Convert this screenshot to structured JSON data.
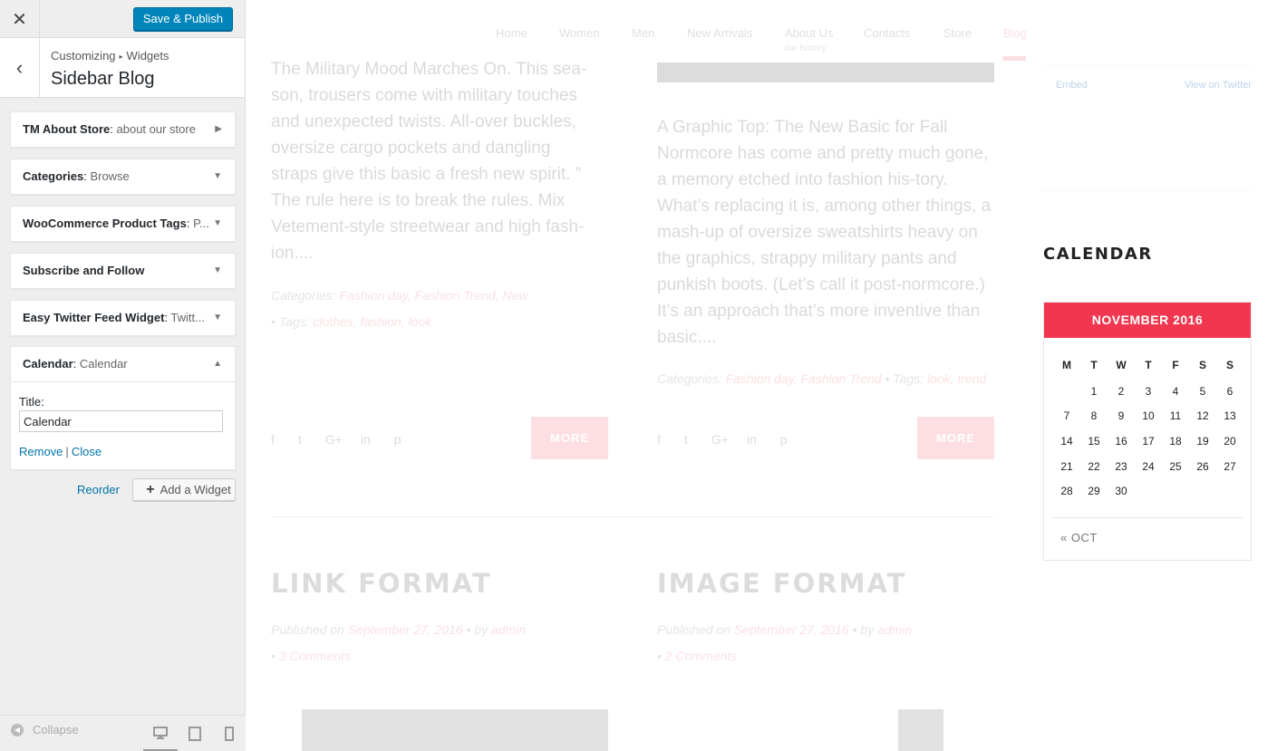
{
  "customizer": {
    "close_icon": "close-icon",
    "publish_label": "Save & Publish",
    "breadcrumb": {
      "root": "Customizing",
      "separator": "▸",
      "current": "Widgets"
    },
    "section_title": "Sidebar Blog",
    "widgets": [
      {
        "name": "TM About Store",
        "sub": "about our store",
        "arrow": "▶"
      },
      {
        "name": "Categories",
        "sub": "Browse",
        "arrow": "▼"
      },
      {
        "name": "WooCommerce Product Tags",
        "sub": "P...",
        "arrow": "▼"
      },
      {
        "name": "Subscribe and Follow",
        "sub": "",
        "arrow": "▼"
      },
      {
        "name": "Easy Twitter Feed Widget",
        "sub": "Twitt...",
        "arrow": "▼"
      },
      {
        "name": "Calendar",
        "sub": "Calendar",
        "arrow": "▲"
      }
    ],
    "calendar_form": {
      "title_label": "Title:",
      "title_value": "Calendar",
      "remove_label": "Remove",
      "separator": "|",
      "close_label": "Close"
    },
    "reorder_label": "Reorder",
    "add_widget_label": "Add a Widget",
    "collapse_label": "Collapse"
  },
  "preview": {
    "nav": {
      "items": [
        "Home",
        "Women",
        "Men",
        "New Arrivals",
        "About Us",
        "Contacts",
        "Store",
        "Blog"
      ],
      "about_sub": "our history"
    },
    "post1": {
      "text": "The Military Mood Marches On. This sea-son, trousers come with military touches and unexpected twists. All-over buckles, oversize cargo pockets and dangling straps give this basic a fresh new spirit. ” The rule here is to break the rules. Mix Vetement-style streetwear and high fash-ion....",
      "categories_label": "Categories:",
      "categories": "Fashion day, Fashion Trend, New",
      "tags_label": "Tags:",
      "tags": "clothes, fashion, look",
      "more": "MORE"
    },
    "post2": {
      "text": "A Graphic Top: The New Basic for Fall Normcore has come and pretty much gone, a memory etched into fashion his-tory. What’s replacing it is, among other things, a mash-up of oversize sweatshirts heavy on the graphics, strappy military pants and punkish boots. (Let’s call it post-normcore.) It’s an approach that’s more inventive than basic....",
      "categories_label": "Categories:",
      "categories": "Fashion day, Fashion Trend",
      "tags_label": "Tags:",
      "tags": "look, trend",
      "more": "MORE"
    },
    "post3": {
      "title": "LINK FORMAT",
      "published_label": "Published on",
      "date": "September 27, 2016",
      "by_label": "by",
      "author": "admin",
      "comments": "3 Comments"
    },
    "post4": {
      "title": "IMAGE FORMAT",
      "published_label": "Published on",
      "date": "September 27, 2016",
      "by_label": "by",
      "author": "admin",
      "comments": "2 Comments"
    },
    "social_icons": [
      "f",
      "t",
      "G+",
      "in",
      "p"
    ],
    "twitter": {
      "embed": "Embed",
      "view": "View on Twitter"
    },
    "calendar": {
      "heading": "CALENDAR",
      "month": "NOVEMBER 2016",
      "weekdays": [
        "M",
        "T",
        "W",
        "T",
        "F",
        "S",
        "S"
      ],
      "weeks": [
        [
          "",
          "1",
          "2",
          "3",
          "4",
          "5",
          "6"
        ],
        [
          "7",
          "8",
          "9",
          "10",
          "11",
          "12",
          "13"
        ],
        [
          "14",
          "15",
          "16",
          "17",
          "18",
          "19",
          "20"
        ],
        [
          "21",
          "22",
          "23",
          "24",
          "25",
          "26",
          "27"
        ],
        [
          "28",
          "29",
          "30",
          "",
          "",
          "",
          ""
        ]
      ],
      "prev_link": "« OCT"
    },
    "accent_color": "#f0374f"
  }
}
